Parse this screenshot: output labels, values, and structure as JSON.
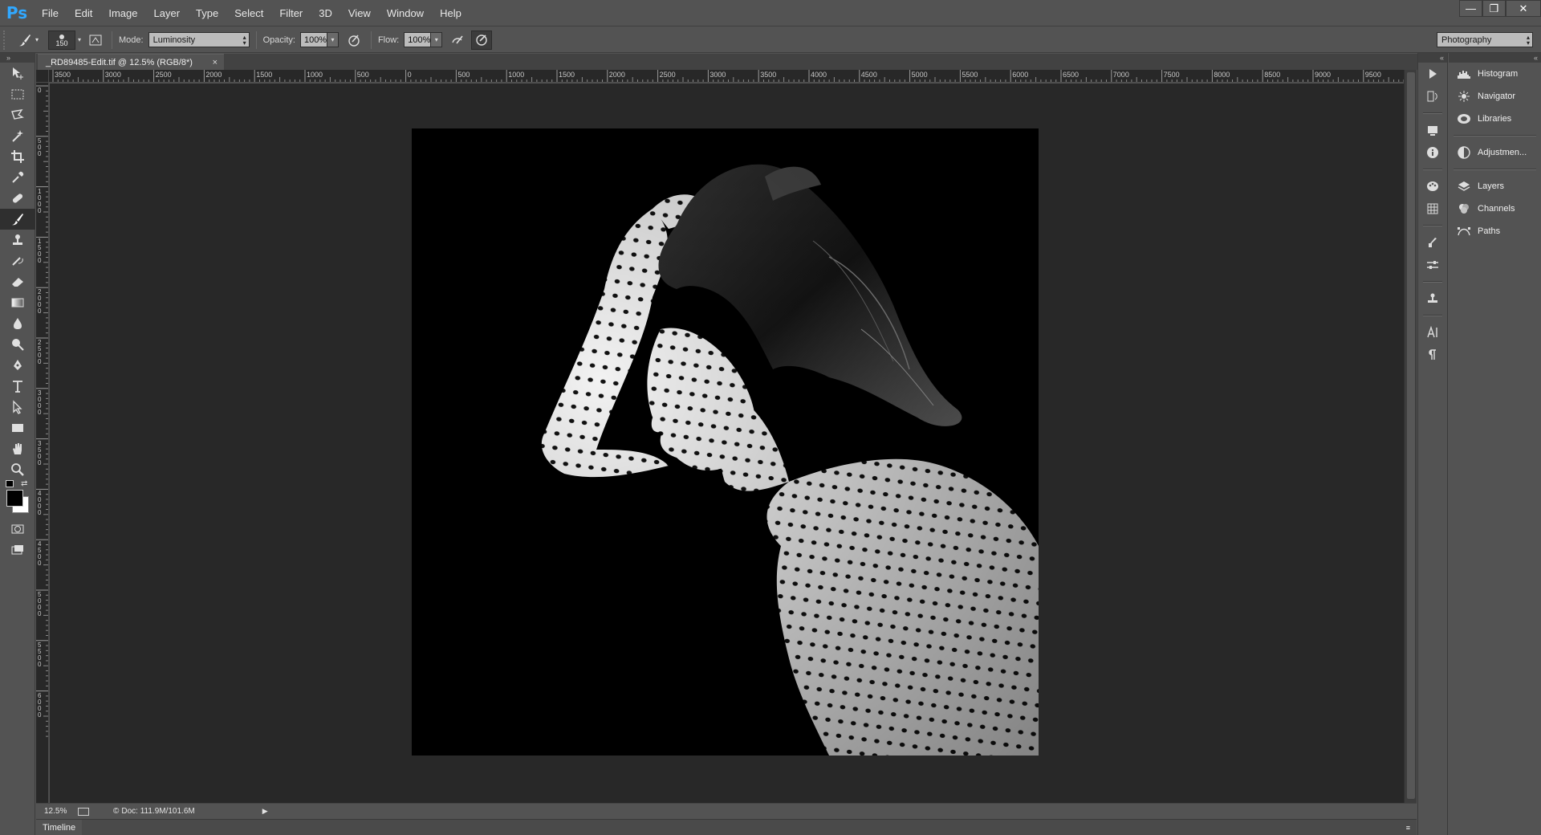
{
  "app": {
    "logo": "Ps"
  },
  "menu": [
    "File",
    "Edit",
    "Image",
    "Layer",
    "Type",
    "Select",
    "Filter",
    "3D",
    "View",
    "Window",
    "Help"
  ],
  "window_controls": {
    "minimize": "—",
    "restore": "❐",
    "close": "✕"
  },
  "options": {
    "brush_size": "150",
    "mode_label": "Mode:",
    "mode_value": "Luminosity",
    "opacity_label": "Opacity:",
    "opacity_value": "100%",
    "flow_label": "Flow:",
    "flow_value": "100%",
    "workspace": "Photography"
  },
  "document": {
    "tab_title": "_RD89485-Edit.tif @ 12.5% (RGB/8*)",
    "close": "×",
    "ruler_top_labels": [
      "3500",
      "3000",
      "2500",
      "2000",
      "1500",
      "1000",
      "500",
      "0",
      "500",
      "1000",
      "1500",
      "2000",
      "2500",
      "3000",
      "3500",
      "4000",
      "4500",
      "5000",
      "5500",
      "6000",
      "6500",
      "7000",
      "7500",
      "8000",
      "8500",
      "9000",
      "9500"
    ],
    "ruler_left_labels": [
      "0",
      "500",
      "1000",
      "1500",
      "2000",
      "2500",
      "3000",
      "3500",
      "4000",
      "4500",
      "5000",
      "5500",
      "6000"
    ]
  },
  "status": {
    "zoom": "12.5%",
    "doc_info": "Doc: 111.9M/101.6M"
  },
  "timeline": {
    "label": "Timeline"
  },
  "panels": [
    {
      "label": "Histogram",
      "icon": "histogram-icon"
    },
    {
      "label": "Navigator",
      "icon": "navigator-icon"
    },
    {
      "label": "Libraries",
      "icon": "libraries-icon"
    },
    {
      "label": "Adjustmen...",
      "icon": "adjustments-icon"
    },
    {
      "label": "Layers",
      "icon": "layers-icon"
    },
    {
      "label": "Channels",
      "icon": "channels-icon"
    },
    {
      "label": "Paths",
      "icon": "paths-icon"
    }
  ]
}
